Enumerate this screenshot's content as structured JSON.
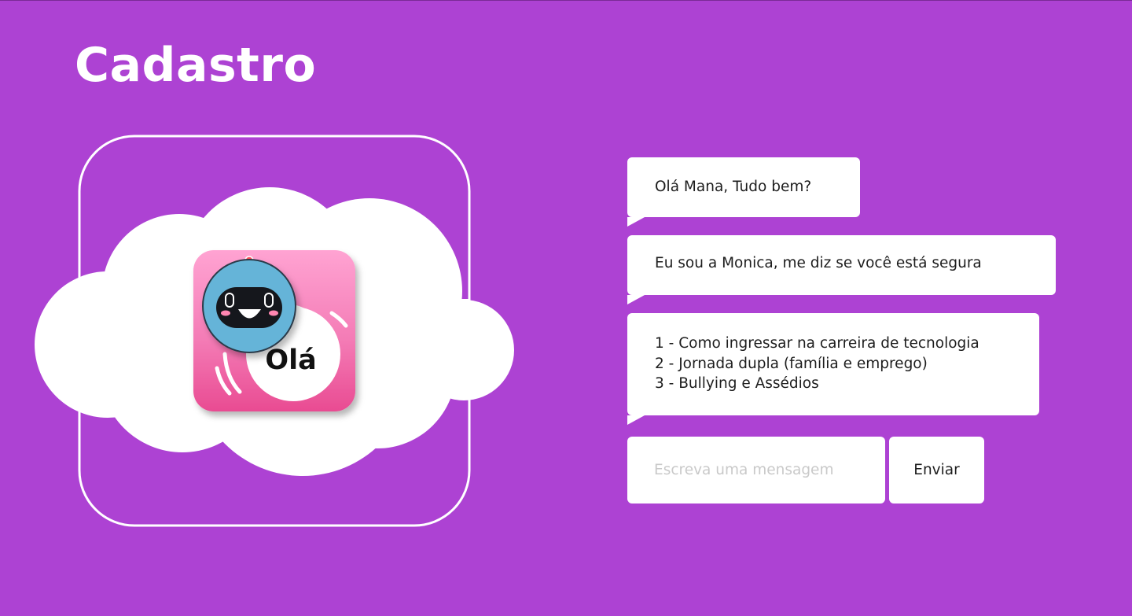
{
  "header": {
    "title": "Cadastro"
  },
  "illustration": {
    "badge_text": "Olá",
    "icon": "chatbot-robot-icon"
  },
  "chat": {
    "messages": [
      {
        "text": "Olá Mana, Tudo bem?"
      },
      {
        "text": "Eu sou a Monica, me diz se você está segura"
      }
    ],
    "menu_options": [
      "1 - Como ingressar na carreira de tecnologia",
      "2 - Jornada dupla (família e emprego)",
      "3 - Bullying e Assédios"
    ]
  },
  "composer": {
    "placeholder": "Escreva uma mensagem",
    "value": "",
    "send_label": "Enviar"
  },
  "colors": {
    "background": "#ad42d3",
    "app_icon_pink": "#ee5fa0",
    "robot_blue": "#60b4d9"
  }
}
